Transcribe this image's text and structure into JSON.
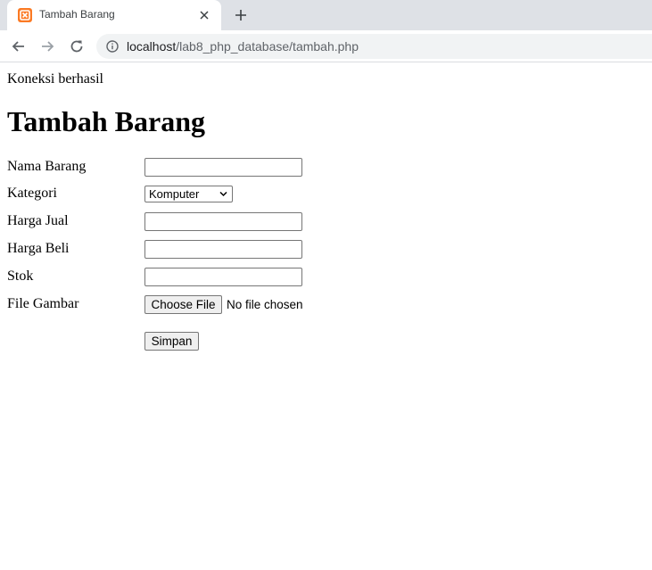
{
  "browser": {
    "tab": {
      "title": "Tambah Barang",
      "favicon": "xampp-icon",
      "close_icon": "close-icon"
    },
    "new_tab_icon": "plus-icon",
    "toolbar": {
      "back_icon": "arrow-back-icon",
      "forward_icon": "arrow-forward-icon",
      "reload_icon": "reload-icon",
      "info_icon": "info-icon"
    },
    "address": {
      "host": "localhost",
      "path": "/lab8_php_database/tambah.php"
    }
  },
  "page": {
    "status": "Koneksi berhasil",
    "title": "Tambah Barang",
    "form": {
      "nama_barang": {
        "label": "Nama Barang",
        "value": ""
      },
      "kategori": {
        "label": "Kategori",
        "selected": "Komputer"
      },
      "harga_jual": {
        "label": "Harga Jual",
        "value": ""
      },
      "harga_beli": {
        "label": "Harga Beli",
        "value": ""
      },
      "stok": {
        "label": "Stok",
        "value": ""
      },
      "file_gambar": {
        "label": "File Gambar",
        "button": "Choose File",
        "status": "No file chosen"
      },
      "submit": "Simpan"
    }
  },
  "colors": {
    "tabstrip": "#dee1e6",
    "omnibox": "#f1f3f4",
    "favicon": "#fb7a24",
    "icon": "#5f6368",
    "icon_disabled": "#9aa0a6"
  }
}
